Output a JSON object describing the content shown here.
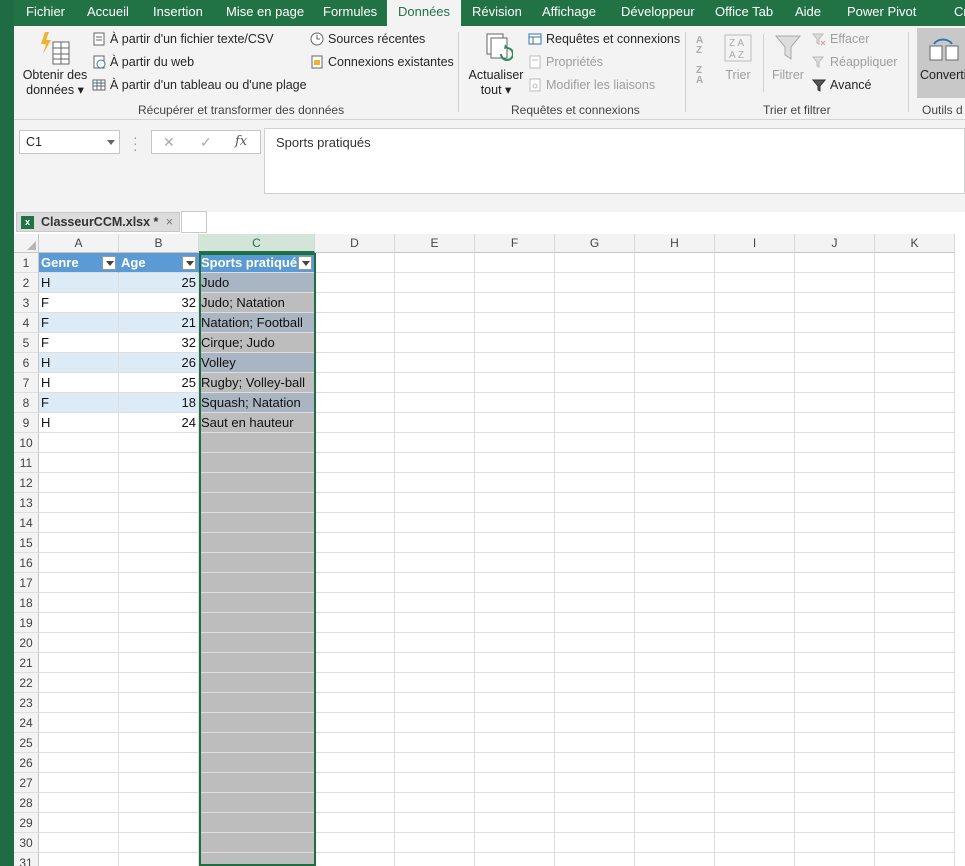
{
  "tabs": [
    {
      "label": "Fichier"
    },
    {
      "label": "Accueil"
    },
    {
      "label": "Insertion"
    },
    {
      "label": "Mise en page"
    },
    {
      "label": "Formules"
    },
    {
      "label": "Données"
    },
    {
      "label": "Révision"
    },
    {
      "label": "Affichage"
    },
    {
      "label": "Développeur"
    },
    {
      "label": "Office Tab"
    },
    {
      "label": "Aide"
    },
    {
      "label": "Power Pivot"
    },
    {
      "label": "Cr"
    }
  ],
  "ribbon": {
    "get_data": {
      "line1": "Obtenir des",
      "line2": "données"
    },
    "from_text": "À partir d'un fichier texte/CSV",
    "from_web": "À partir du web",
    "from_table": "À partir d'un tableau ou d'une plage",
    "recent_sources": "Sources récentes",
    "existing_connections": "Connexions existantes",
    "group1": "Récupérer et transformer des données",
    "refresh": {
      "line1": "Actualiser",
      "line2": "tout"
    },
    "queries_connections": "Requêtes et connexions",
    "properties": "Propriétés",
    "edit_links": "Modifier les liaisons",
    "group2": "Requêtes et connexions",
    "sort": "Trier",
    "filter": "Filtrer",
    "clear": "Effacer",
    "reapply": "Réappliquer",
    "advanced": "Avancé",
    "group3": "Trier et filtrer",
    "convert": "Converti",
    "group4": "Outils d"
  },
  "formula_bar": {
    "name_box": "C1",
    "formula": "Sports pratiqués"
  },
  "workbook_tab": {
    "name": "ClasseurCCM.xlsx *"
  },
  "columns": [
    "A",
    "B",
    "C",
    "D",
    "E",
    "F",
    "G",
    "H",
    "I",
    "J",
    "K"
  ],
  "table": {
    "headers": [
      "Genre",
      "Age",
      "Sports pratiqué"
    ],
    "rows": [
      [
        "H",
        "25",
        "Judo"
      ],
      [
        "F",
        "32",
        "Judo; Natation"
      ],
      [
        "F",
        "21",
        "Natation; Football"
      ],
      [
        "F",
        "32",
        "Cirque; Judo"
      ],
      [
        "H",
        "26",
        "Volley"
      ],
      [
        "H",
        "25",
        "Rugby; Volley-ball"
      ],
      [
        "F",
        "18",
        "Squash; Natation"
      ],
      [
        "H",
        "24",
        "Saut en hauteur"
      ]
    ]
  },
  "row_numbers": [
    "1",
    "2",
    "3",
    "4",
    "5",
    "6",
    "7",
    "8",
    "9",
    "10",
    "11",
    "12",
    "13",
    "14",
    "15",
    "16",
    "17",
    "18",
    "19",
    "20",
    "21",
    "22",
    "23",
    "24",
    "25",
    "26",
    "27",
    "28",
    "29",
    "30",
    "31"
  ],
  "colors": {
    "excel_green": "#217346",
    "table_header": "#5b9bd5",
    "table_band": "#ddebf7",
    "selection": "#bdbdbd"
  }
}
